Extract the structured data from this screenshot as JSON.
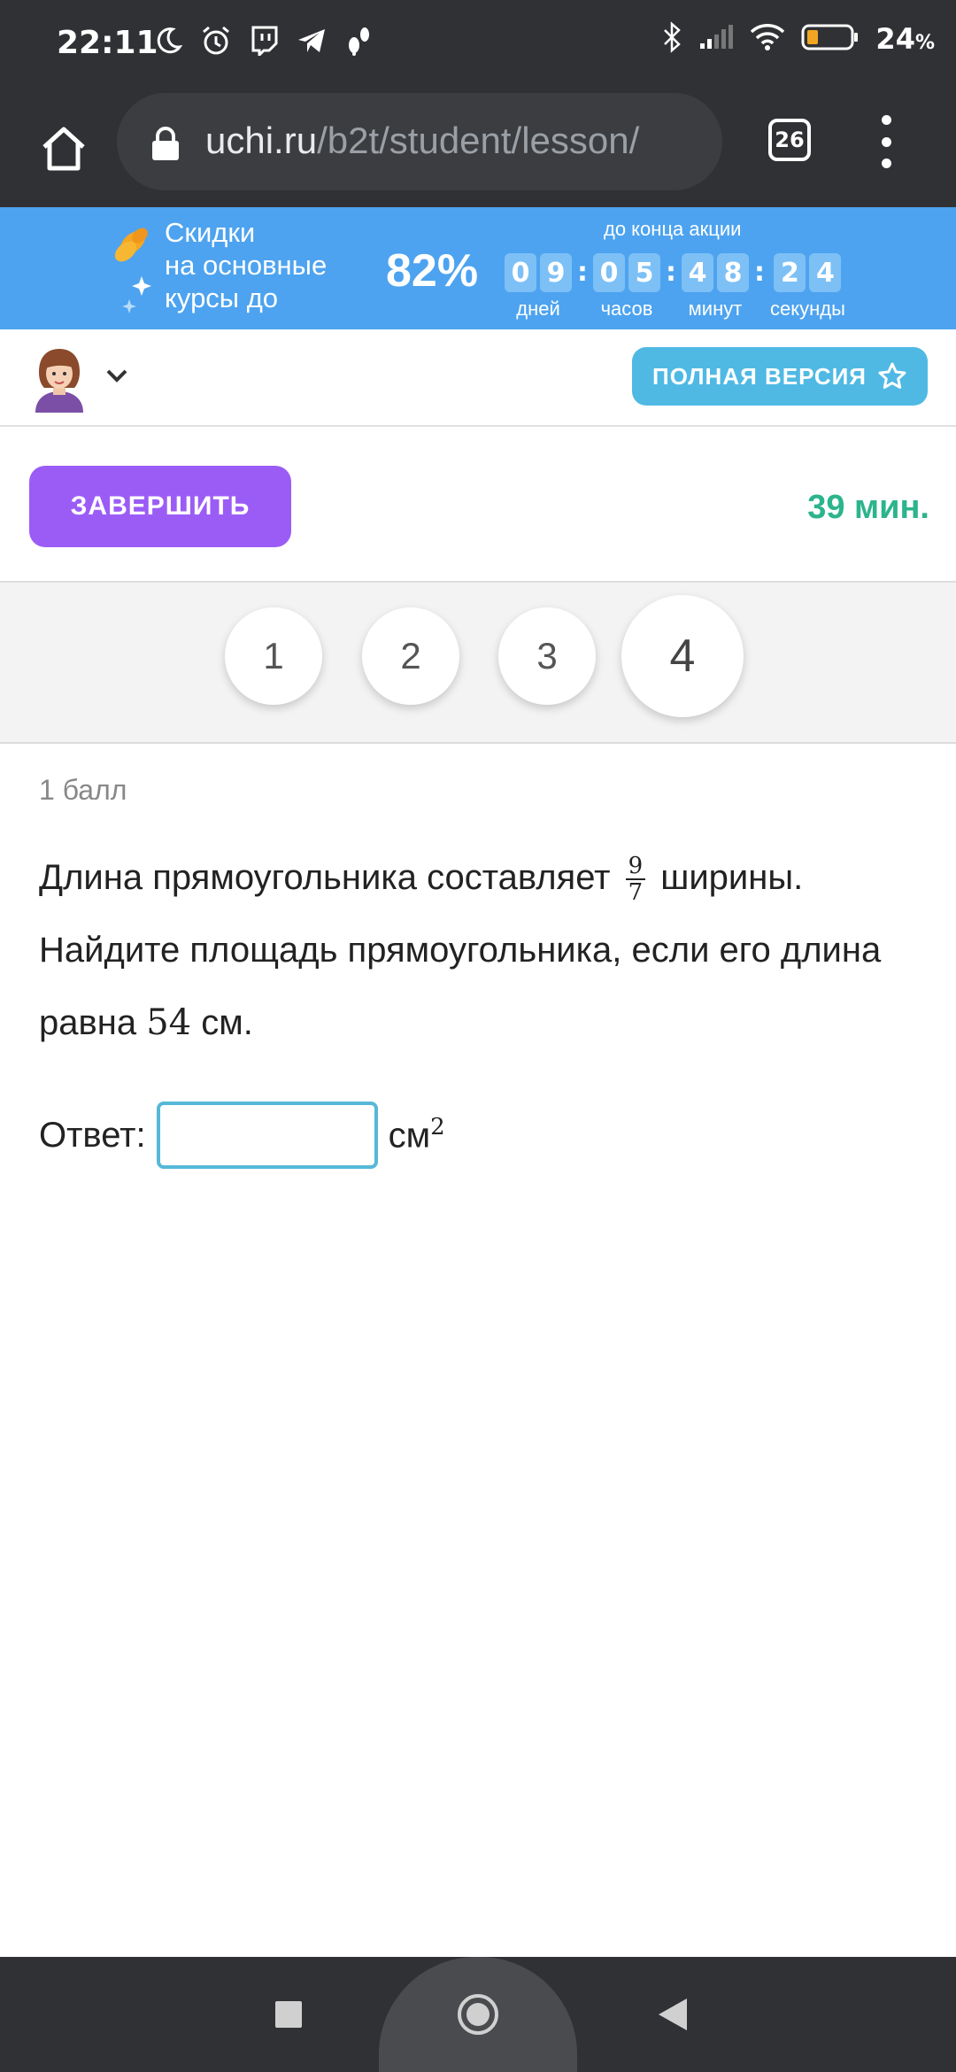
{
  "status_bar": {
    "time": "22:11",
    "battery_percent": "24",
    "battery_unit": "%",
    "icons_left": [
      "moon-icon",
      "alarm-icon",
      "twitch-icon",
      "telegram-icon",
      "notification-icon"
    ],
    "icons_right": [
      "bluetooth-icon",
      "cell-signal-icon",
      "wifi-icon",
      "battery-icon"
    ]
  },
  "browser": {
    "url_domain": "uchi.ru",
    "url_path": "/b2t/student/lesson/",
    "tab_count": "26"
  },
  "promo": {
    "text_lines": [
      "Скидки",
      "на основные",
      "курсы до"
    ],
    "percent": "82%",
    "until_label": "до конца акции",
    "countdown": [
      {
        "digits": [
          "0",
          "9"
        ],
        "label": "дней"
      },
      {
        "digits": [
          "0",
          "5"
        ],
        "label": "часов"
      },
      {
        "digits": [
          "4",
          "8"
        ],
        "label": "минут"
      },
      {
        "digits": [
          "2",
          "4"
        ],
        "label": "секунды"
      }
    ],
    "separator": ":",
    "colors": {
      "background": "#4da3ef",
      "digit_box": "#7dc0f6"
    }
  },
  "header": {
    "full_version_label": "ПОЛНАЯ ВЕРСИЯ"
  },
  "actions": {
    "finish_label": "ЗАВЕРШИТЬ",
    "timer": "39 мин.",
    "colors": {
      "finish": "#9b5cf6",
      "timer": "#2cb48d"
    }
  },
  "question_tabs": [
    {
      "label": "1",
      "active": false
    },
    {
      "label": "2",
      "active": false
    },
    {
      "label": "3",
      "active": false
    },
    {
      "label": "4",
      "active": true
    }
  ],
  "task": {
    "points": "1 балл",
    "text_part1": "Длина прямоугольника составляет ",
    "fraction_num": "9",
    "fraction_den": "7",
    "text_part2": " ширины. Найдите площадь прямоугольника, если его длина равна ",
    "length_value": "54",
    "text_part3": " см.",
    "answer_label": "Ответ:",
    "answer_value": "",
    "unit": "см",
    "unit_power": "2"
  }
}
